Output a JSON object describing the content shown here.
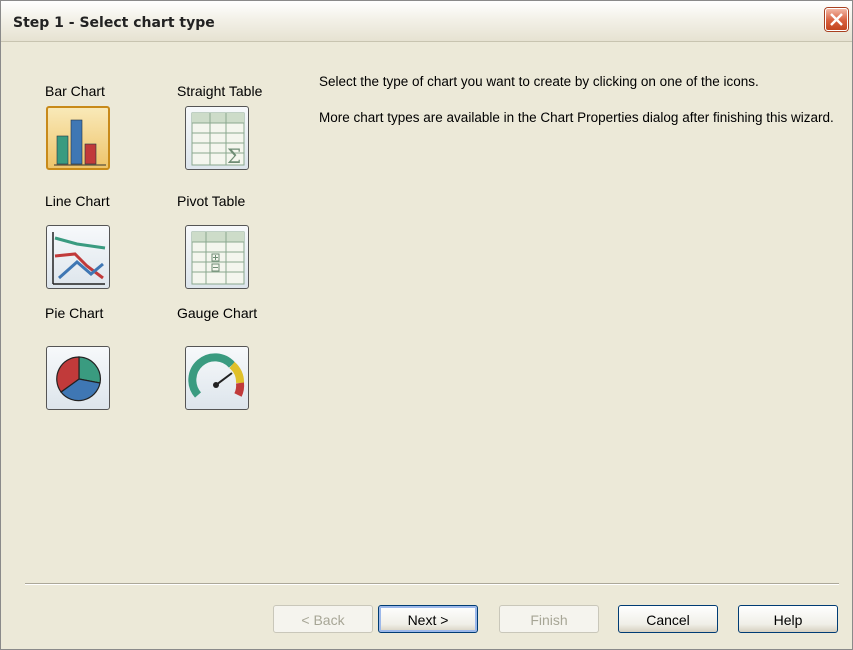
{
  "window": {
    "title": "Step 1 - Select chart type"
  },
  "chart_types": [
    {
      "label": "Bar Chart",
      "icon": "bar-chart-icon",
      "selected": true
    },
    {
      "label": "Straight Table",
      "icon": "straight-table-icon",
      "selected": false
    },
    {
      "label": "Line Chart",
      "icon": "line-chart-icon",
      "selected": false
    },
    {
      "label": "Pivot Table",
      "icon": "pivot-table-icon",
      "selected": false
    },
    {
      "label": "Pie Chart",
      "icon": "pie-chart-icon",
      "selected": false
    },
    {
      "label": "Gauge Chart",
      "icon": "gauge-chart-icon",
      "selected": false
    }
  ],
  "description": {
    "line1": "Select the type of chart you want to create by clicking on one of the icons.",
    "line2": "More chart types are available in the Chart Properties dialog after finishing this wizard."
  },
  "buttons": {
    "back": "< Back",
    "next": "Next >",
    "finish": "Finish",
    "cancel": "Cancel",
    "help": "Help"
  },
  "colors": {
    "dialog_bg": "#ece9d8",
    "selected_border": "#c88a1a",
    "close_button": "#d8603e"
  }
}
